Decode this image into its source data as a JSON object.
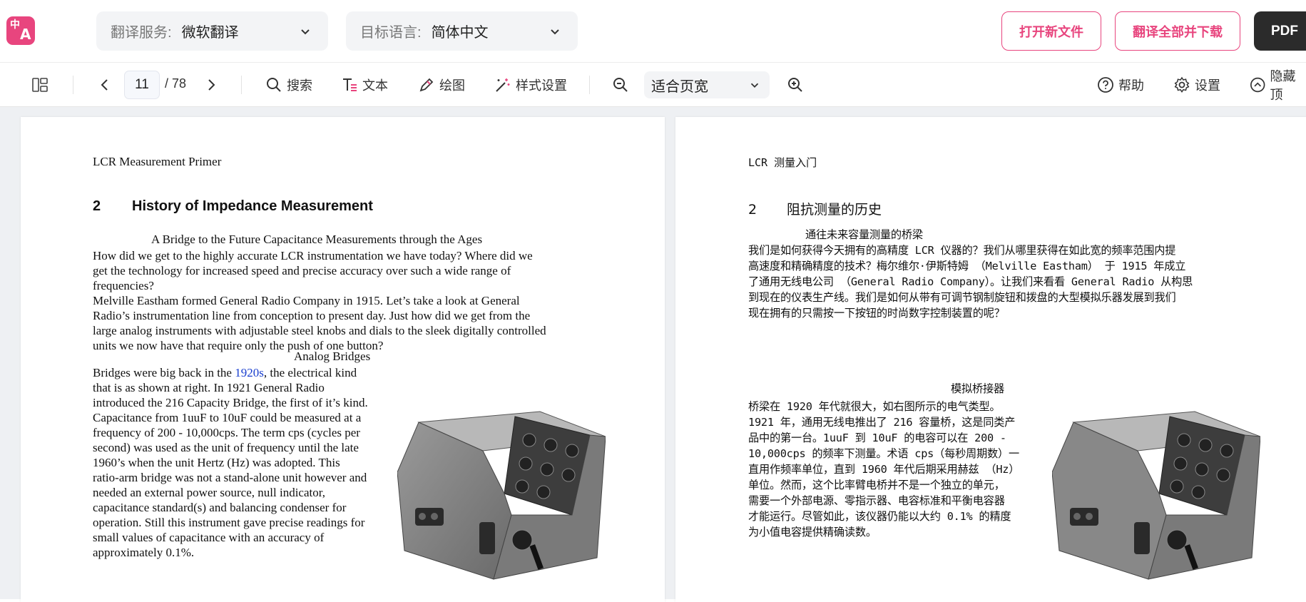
{
  "topbar": {
    "logo": {
      "line1": "中",
      "line2": "A"
    },
    "service": {
      "label": "翻译服务:",
      "value": "微软翻译"
    },
    "target": {
      "label": "目标语言:",
      "value": "简体中文"
    },
    "open_file": "打开新文件",
    "translate_all": "翻译全部并下载",
    "pdf": "PDF"
  },
  "toolbar": {
    "page_current": "11",
    "page_total": "/ 78",
    "search": "搜索",
    "text": "文本",
    "draw": "绘图",
    "style": "样式设置",
    "zoom": "适合页宽",
    "help": "帮助",
    "settings": "设置",
    "hide": "隐藏顶"
  },
  "left_page": {
    "header": "LCR Measurement Primer",
    "section_num": "2",
    "section_title": "History of Impedance Measurement",
    "subtitle1": "A Bridge to the Future Capacitance Measurements through the Ages",
    "para1": [
      "How did we get to the highly accurate LCR instrumentation we have today?  Where did we",
      "get the technology for increased speed and precise accuracy over such a wide range of",
      "frequencies?",
      "Melville Eastham formed General Radio Company in 1915. Let’s take a look at General",
      "Radio’s instrumentation line from conception to present day.  Just how did we get from the",
      "large analog instruments with adjustable steel knobs and dials to the sleek digitally controlled",
      "units we now have that require only the push of one button?"
    ],
    "subtitle2": "Analog Bridges",
    "para2_first_pre": "Bridges were big back in the ",
    "para2_link": "1920s",
    "para2_first_post": ", the electrical kind",
    "para2": [
      "that is as shown at right.  In 1921 General Radio",
      "introduced the 216 Capacity Bridge, the first of it’s kind.",
      "Capacitance from 1uuF to 10uF could be measured at a",
      "frequency of 200 - 10,000cps. The term cps (cycles per",
      "second) was used as the unit of frequency until the late",
      "1960’s when the unit Hertz (Hz) was adopted.  This",
      "ratio-arm bridge was not a stand-alone unit however and",
      "needed an external power source, null indicator,",
      "capacitance standard(s) and balancing condenser for",
      "operation. Still this instrument gave precise readings for",
      "small values of capacitance with an accuracy of",
      "approximately 0.1%."
    ]
  },
  "right_page": {
    "header": "LCR 测量入门",
    "section_num": "2",
    "section_title": "阻抗测量的历史",
    "subtitle1": "通往未来容量测量的桥梁",
    "para1": [
      "我们是如何获得今天拥有的高精度 LCR 仪器的？我们从哪里获得在如此宽的频率范围内提",
      "高速度和精确精度的技术？梅尔维尔·伊斯特姆 （Melville Eastham） 于 1915 年成立",
      "了通用无线电公司 （General Radio Company）。让我们来看看 General Radio 从构思",
      "到现在的仪表生产线。我们是如何从带有可调节钢制旋钮和拨盘的大型模拟乐器发展到我们",
      "现在拥有的只需按一下按钮的时尚数字控制装置的呢？"
    ],
    "subtitle2": "模拟桥接器",
    "para2": [
      "桥梁在 1920 年代就很大，如右图所示的电气类型。",
      "1921 年，通用无线电推出了 216 容量桥，这是同类产",
      "品中的第一台。1uuF 到 10uF 的电容可以在 200 -",
      "10,000cps 的频率下测量。术语 cps（每秒周期数）一",
      "直用作频率单位，直到 1960 年代后期采用赫兹 （Hz）",
      "单位。然而，这个比率臂电桥并不是一个独立的单元，",
      "需要一个外部电源、零指示器、电容标准和平衡电容器",
      "才能运行。尽管如此，该仪器仍能以大约 0.1% 的精度",
      "为小值电容提供精确读数。"
    ]
  }
}
